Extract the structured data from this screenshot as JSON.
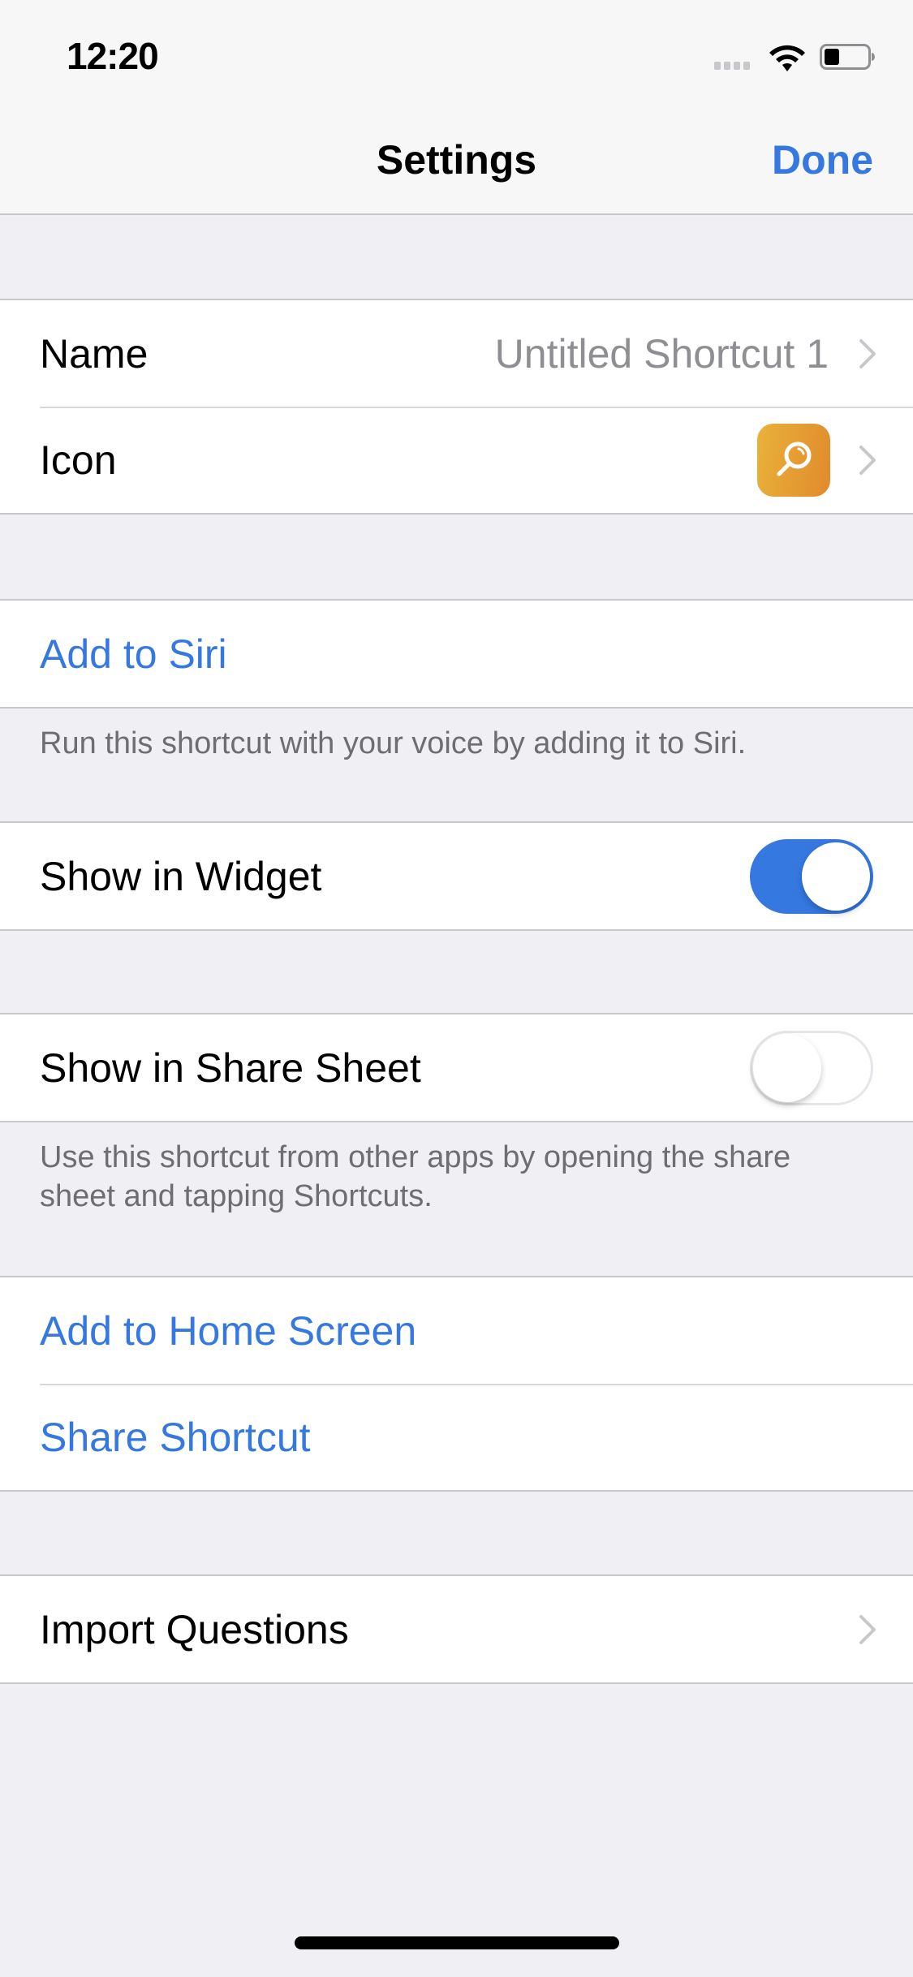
{
  "status_bar": {
    "time": "12:20",
    "icons": [
      "cellular-signal-icon",
      "wifi-icon",
      "battery-icon"
    ]
  },
  "nav": {
    "title": "Settings",
    "done_label": "Done"
  },
  "colors": {
    "accent": "#3478e0",
    "background": "#efeff4",
    "icon_gradient_start": "#e9b23a",
    "icon_gradient_end": "#e18a2c"
  },
  "sections": {
    "general": {
      "name_label": "Name",
      "name_value": "Untitled Shortcut 1",
      "icon_label": "Icon",
      "icon_glyph": "magnifying-glass-icon"
    },
    "siri": {
      "add_label": "Add to Siri",
      "footer": "Run this shortcut with your voice by adding it to Siri."
    },
    "widget": {
      "label": "Show in Widget",
      "enabled": true
    },
    "share_sheet": {
      "label": "Show in Share Sheet",
      "enabled": false,
      "footer": "Use this shortcut from other apps by opening the share sheet and tapping Shortcuts."
    },
    "actions": {
      "home_screen_label": "Add to Home Screen",
      "share_label": "Share Shortcut"
    },
    "import": {
      "label": "Import Questions"
    }
  }
}
